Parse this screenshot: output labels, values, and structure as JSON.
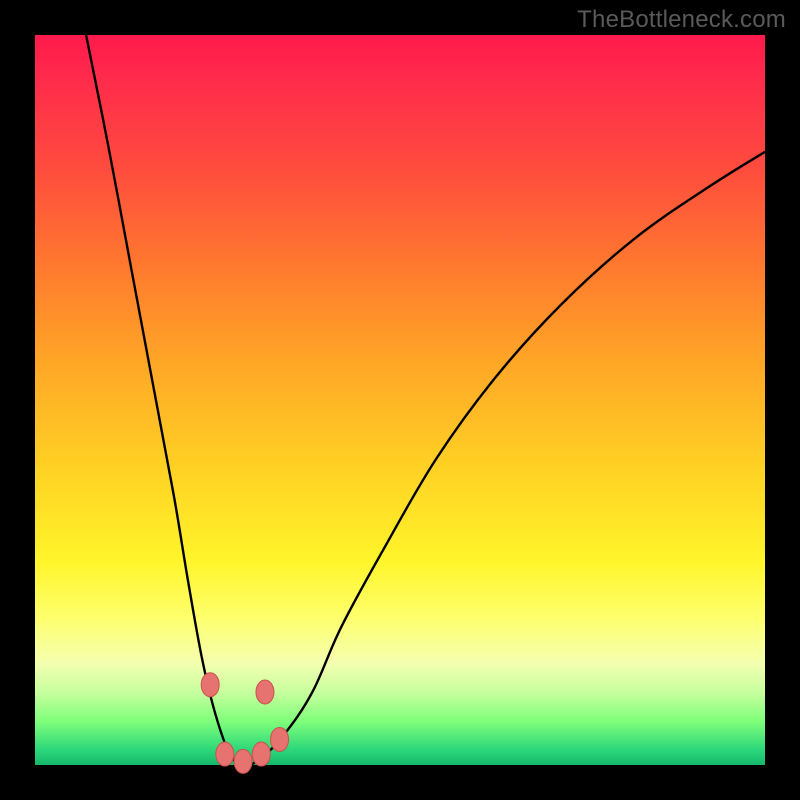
{
  "watermark": "TheBottleneck.com",
  "colors": {
    "frame": "#000000",
    "curve_stroke": "#000000",
    "marker_fill": "#e6736f",
    "marker_stroke": "#c9524e"
  },
  "chart_data": {
    "type": "line",
    "title": "",
    "xlabel": "",
    "ylabel": "",
    "xlim": [
      0,
      100
    ],
    "ylim": [
      0,
      100
    ],
    "grid": false,
    "legend": false,
    "series": [
      {
        "name": "bottleneck-v-curve",
        "x": [
          7,
          10,
          13,
          16,
          19,
          21,
          23,
          25,
          27,
          29,
          31,
          34,
          38,
          42,
          48,
          55,
          63,
          72,
          82,
          92,
          100
        ],
        "y": [
          100,
          85,
          69,
          53,
          37,
          25,
          14,
          6,
          1,
          0,
          1,
          4,
          10,
          19,
          30,
          42,
          53,
          63,
          72,
          79,
          84
        ]
      }
    ],
    "annotations": [],
    "markers": {
      "name": "solution-markers",
      "points": [
        {
          "x": 24.0,
          "y": 11.0
        },
        {
          "x": 31.5,
          "y": 10.0
        },
        {
          "x": 26.0,
          "y": 1.5
        },
        {
          "x": 28.5,
          "y": 0.5
        },
        {
          "x": 31.0,
          "y": 1.5
        },
        {
          "x": 33.5,
          "y": 3.5
        }
      ]
    }
  }
}
